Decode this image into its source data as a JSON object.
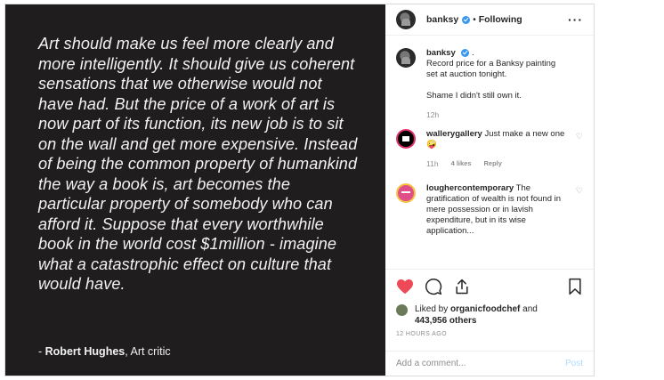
{
  "image": {
    "quote": "Art should make us feel more clearly and more intelligently. It should give us coherent sensations that we otherwise would not have had. But the price of a work of art is now part of its function, its new job is to sit on the wall and get more expensive. Instead of being the common property of humankind the way a book is, art becomes the particular property of somebody who can afford it. Suppose that every worthwhile book in the world cost $1million - imagine what a catastrophic effect on culture that would have.",
    "attribution_prefix": "- ",
    "attribution_name": "Robert Hughes",
    "attribution_role": ", Art critic"
  },
  "header": {
    "username": "banksy",
    "separator": "•",
    "follow_label": "Following",
    "more_label": "···"
  },
  "caption": {
    "username": "banksy",
    "suffix": ".",
    "line1": "Record price for a Banksy painting set at auction tonight.",
    "line2": "Shame I didn't still own it.",
    "time": "12h"
  },
  "comments": [
    {
      "username": "wallerygallery",
      "text": "Just make a new one 🤪",
      "time": "11h",
      "likes": "4 likes",
      "reply_label": "Reply"
    },
    {
      "username": "lougher​contemporary",
      "text": "The gratification of wealth is not found in mere possession or in lavish expenditure, but in its wise application..."
    }
  ],
  "likes": {
    "prefix": "Liked by ",
    "user": "organicfoodchef",
    "middle": " and",
    "count": "443,956 others"
  },
  "time_ago": "12 HOURS AGO",
  "add_comment": {
    "placeholder": "Add a comment...",
    "post_label": "Post"
  },
  "colors": {
    "image_bg": "#1f1d1e",
    "like_red": "#ed4956",
    "verified_blue": "#3897f0",
    "post_disabled": "#b3dbff"
  }
}
